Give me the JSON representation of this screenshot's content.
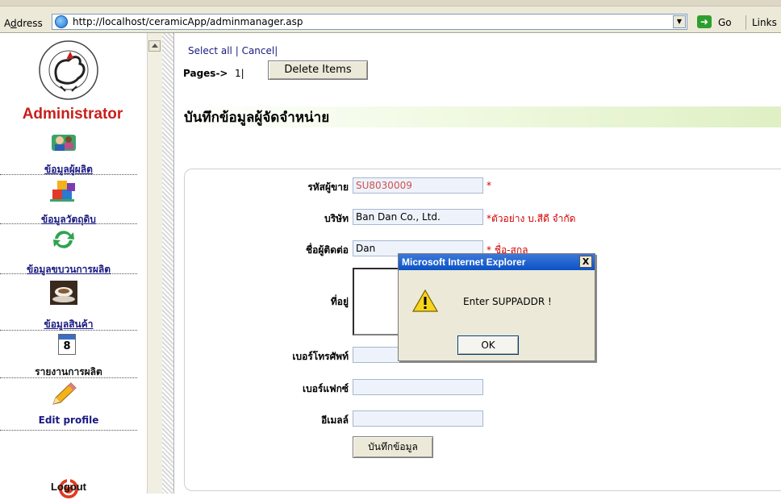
{
  "browser": {
    "address_label_prefix": "A",
    "address_label_underlined": "d",
    "address_label_rest": "dress",
    "url": "http://localhost/ceramicApp/adminmanager.asp",
    "go_label": "Go",
    "links_label": "Links"
  },
  "sidebar": {
    "title": "Administrator",
    "items": [
      {
        "label": "ข้อมูลผู้ผลิต",
        "icon": "users-icon"
      },
      {
        "label": "ข้อมูลวัตถุดิบ",
        "icon": "blocks-icon"
      },
      {
        "label": "ข้อมูลขบวนการผลิต",
        "icon": "refresh-icon"
      },
      {
        "label": "ข้อมูลสินค้า",
        "icon": "product-icon"
      },
      {
        "label": "รายงานการผลิต",
        "icon": "calendar-icon",
        "calendar_number": "8"
      },
      {
        "label": "Edit profile",
        "icon": "pencil-icon"
      }
    ],
    "logout_label": "Logout"
  },
  "toolbar": {
    "select_all": "Select all",
    "sep1": "|",
    "cancel": "Cancel",
    "sep2": "|",
    "pages_label": "Pages->",
    "page_number": "1|",
    "delete_button": "Delete Items"
  },
  "form": {
    "section_title": "บันทึกข้อมูลผู้จัดจำหน่าย",
    "fields": [
      {
        "label": "รหัสผู้ขาย",
        "value": "SU8030009",
        "hint": "*"
      },
      {
        "label": "บริษัท",
        "value": "Ban Dan Co., Ltd.",
        "hint": "*ตัวอย่าง บ.สีดี จำกัด"
      },
      {
        "label": "ชื่อผู้ติดต่อ",
        "value": "Dan",
        "hint": "* ชื่อ-สกุล"
      },
      {
        "label": "ที่อยู่",
        "value": ""
      },
      {
        "label": "เบอร์โทรศัพท์",
        "value": ""
      },
      {
        "label": "เบอร์แฟกซ์",
        "value": ""
      },
      {
        "label": "อีเมลล์",
        "value": ""
      }
    ],
    "submit_label": "บันทึกข้อมูล"
  },
  "dialog": {
    "title": "Microsoft Internet Explorer",
    "close_glyph": "X",
    "message": "Enter SUPPADDR !",
    "ok_label": "OK"
  },
  "colors": {
    "accent_red": "#c8201b",
    "field_bg": "#eef3fb",
    "required_red": "#d40000",
    "titlebar_blue": "#0a52c7"
  }
}
